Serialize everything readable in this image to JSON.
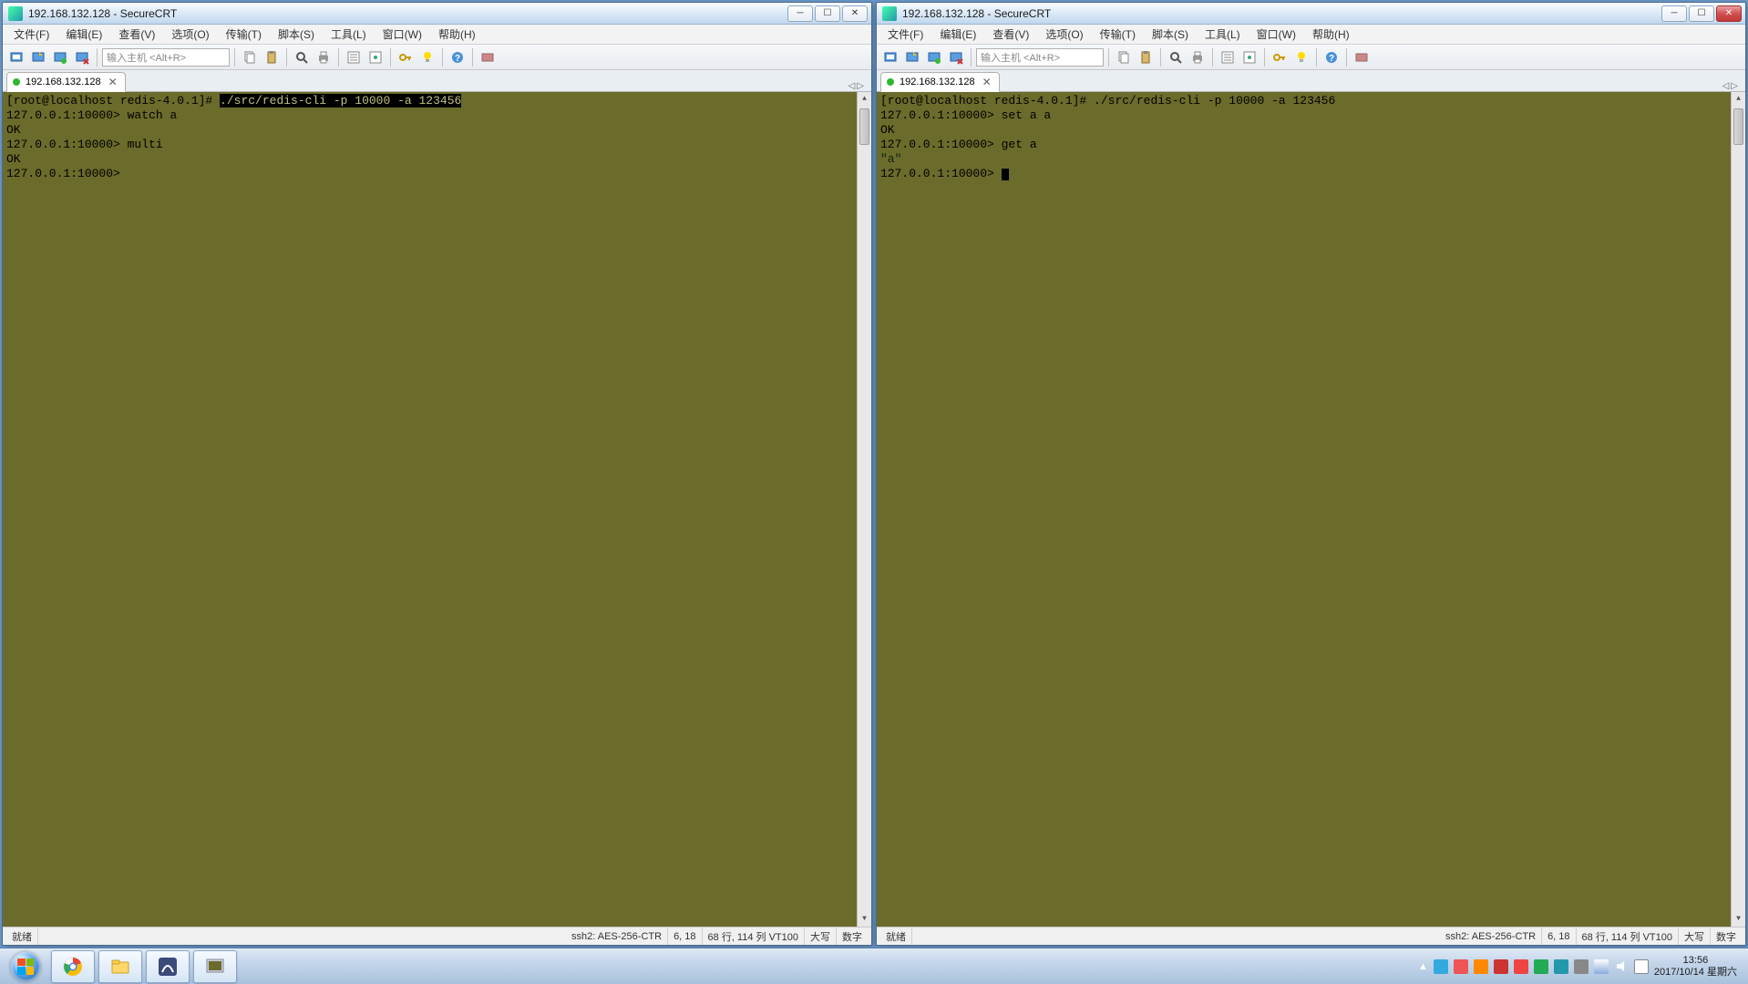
{
  "left": {
    "title": "192.168.132.128 - SecureCRT",
    "tab": "192.168.132.128",
    "menu": [
      "文件(F)",
      "编辑(E)",
      "查看(V)",
      "选项(O)",
      "传输(T)",
      "脚本(S)",
      "工具(L)",
      "窗口(W)",
      "帮助(H)"
    ],
    "host_placeholder": "输入主机 <Alt+R>",
    "terminal": {
      "line1_pre": "[root@localhost redis-4.0.1]# ",
      "line1_cmd": "./src/redis-cli -p 10000 -a 123456",
      "line2": "127.0.0.1:10000> watch a",
      "line3": "OK",
      "line4": "127.0.0.1:10000> multi",
      "line5": "OK",
      "line6": "127.0.0.1:10000> "
    },
    "status": {
      "ready": "就绪",
      "proto": "ssh2: AES-256-CTR",
      "pos": "6, 18",
      "size": "68 行, 114 列 VT100",
      "caps": "大写",
      "num": "数字"
    }
  },
  "right": {
    "title": "192.168.132.128 - SecureCRT",
    "tab": "192.168.132.128",
    "menu": [
      "文件(F)",
      "编辑(E)",
      "查看(V)",
      "选项(O)",
      "传输(T)",
      "脚本(S)",
      "工具(L)",
      "窗口(W)",
      "帮助(H)"
    ],
    "host_placeholder": "输入主机 <Alt+R>",
    "terminal": {
      "line1": "[root@localhost redis-4.0.1]# ./src/redis-cli -p 10000 -a 123456",
      "line2": "127.0.0.1:10000> set a a",
      "line3": "OK",
      "line4": "127.0.0.1:10000> get a",
      "line5": "\"a\"",
      "line6": "127.0.0.1:10000> "
    },
    "status": {
      "ready": "就绪",
      "proto": "ssh2: AES-256-CTR",
      "pos": "6, 18",
      "size": "68 行, 114 列 VT100",
      "caps": "大写",
      "num": "数字"
    }
  },
  "taskbar": {
    "time": "13:56",
    "date": "2017/10/14 星期六"
  }
}
